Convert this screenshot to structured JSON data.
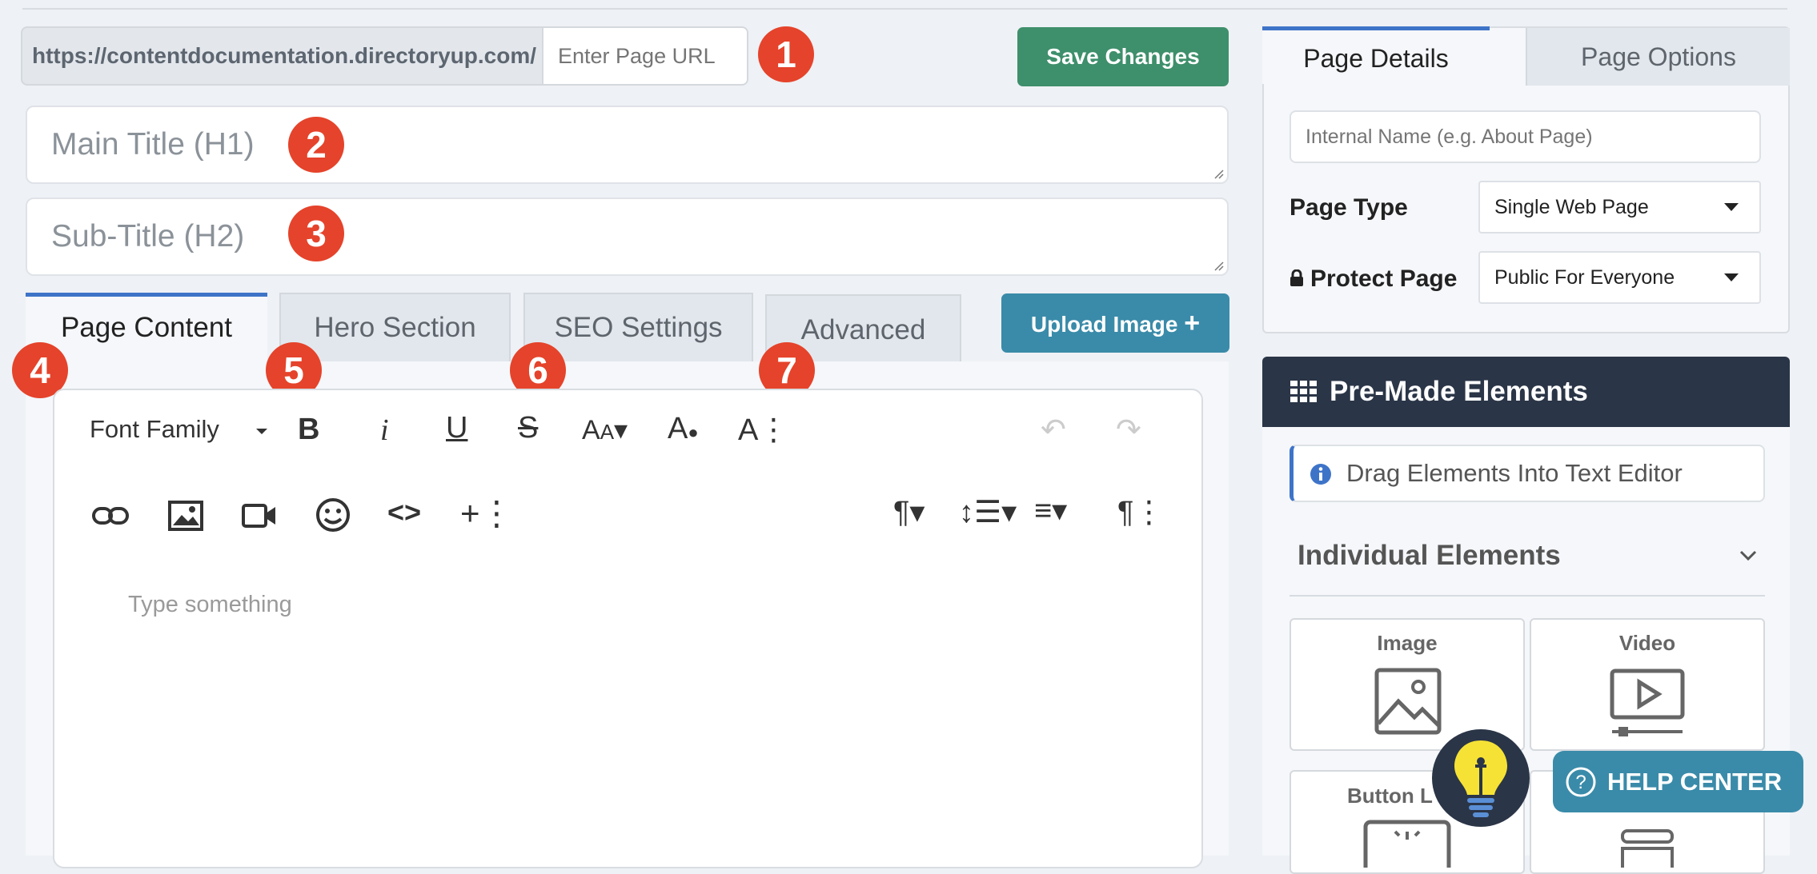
{
  "url_bar": {
    "prefix": "https://contentdocumentation.directoryup.com/",
    "placeholder": "Enter Page URL"
  },
  "badges": [
    "1",
    "2",
    "3",
    "4",
    "5",
    "6",
    "7"
  ],
  "save_label": "Save Changes",
  "main_title_placeholder": "Main Title (H1)",
  "subtitle_placeholder": "Sub-Title (H2)",
  "tabs": [
    {
      "label": "Page Content"
    },
    {
      "label": "Hero Section"
    },
    {
      "label": "SEO Settings"
    },
    {
      "label": "Advanced"
    }
  ],
  "upload_label": "Upload Image",
  "editor": {
    "font_family_label": "Font Family",
    "placeholder": "Type something"
  },
  "right_panel": {
    "tabs": [
      "Page Details",
      "Page Options"
    ],
    "internal_name_placeholder": "Internal Name (e.g. About Page)",
    "page_type_label": "Page Type",
    "page_type_value": "Single Web Page",
    "protect_label": "Protect Page",
    "protect_value": "Public For Everyone"
  },
  "premade": {
    "title": "Pre-Made Elements",
    "hint": "Drag Elements Into Text Editor",
    "section": "Individual Elements",
    "cards": [
      {
        "label": "Image"
      },
      {
        "label": "Video"
      },
      {
        "label": "Button L"
      }
    ]
  },
  "help_label": "HELP CENTER",
  "colors": {
    "accent": "#3e74c8",
    "save": "#3e8f6b",
    "upload": "#3a8ba9",
    "badge": "#e5432b",
    "header": "#2a3547"
  }
}
